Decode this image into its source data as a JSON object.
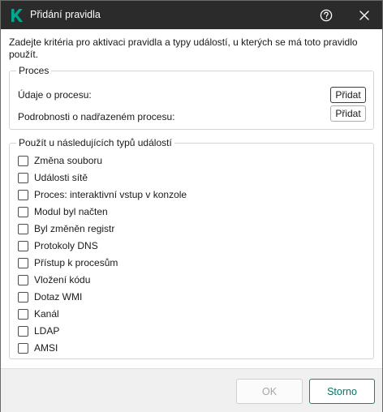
{
  "window": {
    "title": "Přidání pravidla",
    "intro": "Zadejte kritéria pro aktivaci pravidla a typy událostí, u kterých se má toto pravidlo použít."
  },
  "process_group": {
    "legend": "Proces",
    "rows": [
      {
        "label": "Údaje o procesu:",
        "button": "Přidat"
      },
      {
        "label": "Podrobnosti o nadřazeném procesu:",
        "button": "Přidat"
      }
    ]
  },
  "events_group": {
    "legend": "Použít u následujících typů událostí",
    "items": [
      {
        "label": "Změna souboru",
        "checked": false
      },
      {
        "label": "Události sítě",
        "checked": false
      },
      {
        "label": "Proces: interaktivní vstup v konzole",
        "checked": false
      },
      {
        "label": "Modul byl načten",
        "checked": false
      },
      {
        "label": "Byl změněn registr",
        "checked": false
      },
      {
        "label": "Protokoly DNS",
        "checked": false
      },
      {
        "label": "Přístup k procesům",
        "checked": false
      },
      {
        "label": "Vložení kódu",
        "checked": false
      },
      {
        "label": "Dotaz WMI",
        "checked": false
      },
      {
        "label": "Kanál",
        "checked": false
      },
      {
        "label": "LDAP",
        "checked": false
      },
      {
        "label": "AMSI",
        "checked": false
      }
    ]
  },
  "footer": {
    "ok_label": "OK",
    "cancel_label": "Storno"
  },
  "colors": {
    "titlebar": "#2b2b2b",
    "brand": "#00a88e",
    "accent_button_border": "#0a8a76",
    "disabled_text": "#a6a6a6"
  },
  "icons": {
    "app": "kaspersky-k-icon",
    "help": "help-icon",
    "close": "close-icon"
  }
}
